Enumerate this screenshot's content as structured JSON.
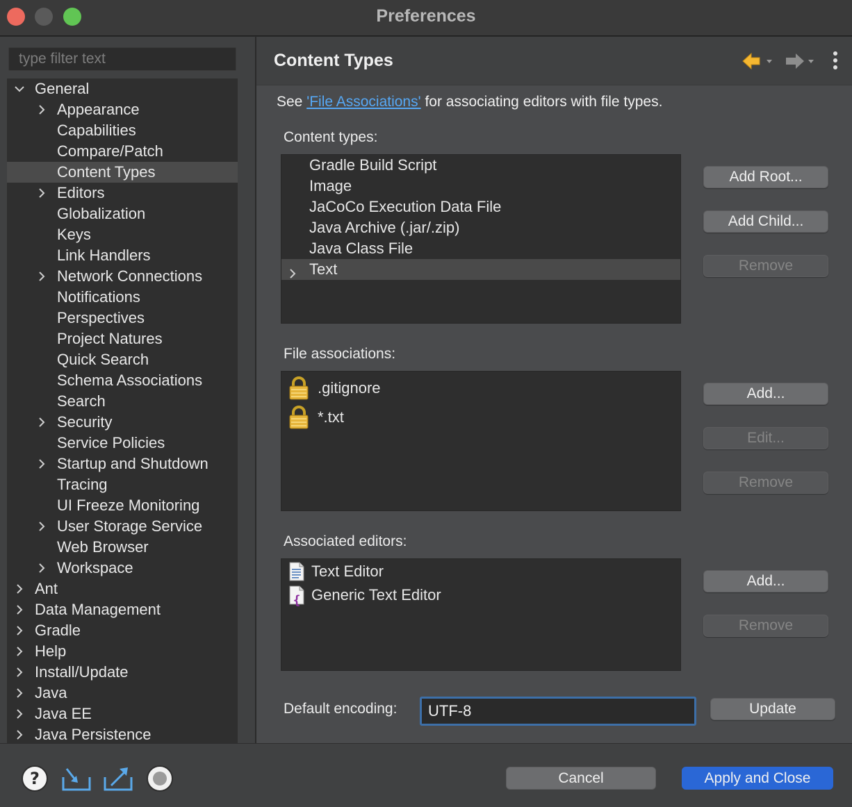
{
  "window": {
    "title": "Preferences"
  },
  "sidebar": {
    "filter_placeholder": "type filter text",
    "tree": [
      {
        "label": "General",
        "level": 0,
        "expander": "expanded",
        "selected": false
      },
      {
        "label": "Appearance",
        "level": 1,
        "expander": "collapsed",
        "selected": false
      },
      {
        "label": "Capabilities",
        "level": 1,
        "expander": "none",
        "selected": false
      },
      {
        "label": "Compare/Patch",
        "level": 1,
        "expander": "none",
        "selected": false
      },
      {
        "label": "Content Types",
        "level": 1,
        "expander": "none",
        "selected": true
      },
      {
        "label": "Editors",
        "level": 1,
        "expander": "collapsed",
        "selected": false
      },
      {
        "label": "Globalization",
        "level": 1,
        "expander": "none",
        "selected": false
      },
      {
        "label": "Keys",
        "level": 1,
        "expander": "none",
        "selected": false
      },
      {
        "label": "Link Handlers",
        "level": 1,
        "expander": "none",
        "selected": false
      },
      {
        "label": "Network Connections",
        "level": 1,
        "expander": "collapsed",
        "selected": false
      },
      {
        "label": "Notifications",
        "level": 1,
        "expander": "none",
        "selected": false
      },
      {
        "label": "Perspectives",
        "level": 1,
        "expander": "none",
        "selected": false
      },
      {
        "label": "Project Natures",
        "level": 1,
        "expander": "none",
        "selected": false
      },
      {
        "label": "Quick Search",
        "level": 1,
        "expander": "none",
        "selected": false
      },
      {
        "label": "Schema Associations",
        "level": 1,
        "expander": "none",
        "selected": false
      },
      {
        "label": "Search",
        "level": 1,
        "expander": "none",
        "selected": false
      },
      {
        "label": "Security",
        "level": 1,
        "expander": "collapsed",
        "selected": false
      },
      {
        "label": "Service Policies",
        "level": 1,
        "expander": "none",
        "selected": false
      },
      {
        "label": "Startup and Shutdown",
        "level": 1,
        "expander": "collapsed",
        "selected": false
      },
      {
        "label": "Tracing",
        "level": 1,
        "expander": "none",
        "selected": false
      },
      {
        "label": "UI Freeze Monitoring",
        "level": 1,
        "expander": "none",
        "selected": false
      },
      {
        "label": "User Storage Service",
        "level": 1,
        "expander": "collapsed",
        "selected": false
      },
      {
        "label": "Web Browser",
        "level": 1,
        "expander": "none",
        "selected": false
      },
      {
        "label": "Workspace",
        "level": 1,
        "expander": "collapsed",
        "selected": false
      },
      {
        "label": "Ant",
        "level": 0,
        "expander": "collapsed",
        "selected": false
      },
      {
        "label": "Data Management",
        "level": 0,
        "expander": "collapsed",
        "selected": false
      },
      {
        "label": "Gradle",
        "level": 0,
        "expander": "collapsed",
        "selected": false
      },
      {
        "label": "Help",
        "level": 0,
        "expander": "collapsed",
        "selected": false
      },
      {
        "label": "Install/Update",
        "level": 0,
        "expander": "collapsed",
        "selected": false
      },
      {
        "label": "Java",
        "level": 0,
        "expander": "collapsed",
        "selected": false
      },
      {
        "label": "Java EE",
        "level": 0,
        "expander": "collapsed",
        "selected": false
      },
      {
        "label": "Java Persistence",
        "level": 0,
        "expander": "collapsed",
        "selected": false
      }
    ]
  },
  "main": {
    "title": "Content Types",
    "nav": {
      "back_icon": "back-arrow-icon",
      "forward_icon": "forward-arrow-icon",
      "menu_icon": "kebab-menu-icon"
    },
    "info": {
      "prefix": "See ",
      "link": "'File Associations'",
      "suffix": " for associating editors with file types."
    },
    "content_types": {
      "label": "Content types:",
      "items": [
        {
          "label": "Gradle Build Script",
          "expander": "none",
          "selected": false
        },
        {
          "label": "Image",
          "expander": "none",
          "selected": false
        },
        {
          "label": "JaCoCo Execution Data File",
          "expander": "none",
          "selected": false
        },
        {
          "label": "Java Archive (.jar/.zip)",
          "expander": "none",
          "selected": false
        },
        {
          "label": "Java Class File",
          "expander": "none",
          "selected": false
        },
        {
          "label": "Text",
          "expander": "collapsed",
          "selected": true
        }
      ],
      "buttons": [
        {
          "label": "Add Root...",
          "enabled": true
        },
        {
          "label": "Add Child...",
          "enabled": true
        },
        {
          "label": "Remove",
          "enabled": false
        }
      ]
    },
    "file_associations": {
      "label": "File associations:",
      "items": [
        {
          "label": ".gitignore",
          "icon": "lock-icon"
        },
        {
          "label": "*.txt",
          "icon": "lock-icon"
        }
      ],
      "buttons": [
        {
          "label": "Add...",
          "enabled": true
        },
        {
          "label": "Edit...",
          "enabled": false
        },
        {
          "label": "Remove",
          "enabled": false
        }
      ]
    },
    "associated_editors": {
      "label": "Associated editors:",
      "items": [
        {
          "label": "Text Editor",
          "icon": "text-file-icon"
        },
        {
          "label": "Generic Text Editor",
          "icon": "generic-editor-icon"
        }
      ],
      "buttons": [
        {
          "label": "Add...",
          "enabled": true
        },
        {
          "label": "Remove",
          "enabled": false
        }
      ]
    },
    "encoding": {
      "label": "Default encoding:",
      "value": "UTF-8",
      "update_label": "Update"
    }
  },
  "footer": {
    "icons": [
      "help-icon",
      "import-icon",
      "export-icon",
      "record-icon"
    ],
    "cancel_label": "Cancel",
    "apply_label": "Apply and Close"
  },
  "colors": {
    "accent": "#2a67d6",
    "link": "#56a8f5",
    "back_arrow": "#f5b731",
    "close": "#ed6a5e",
    "maximize": "#61c554"
  }
}
